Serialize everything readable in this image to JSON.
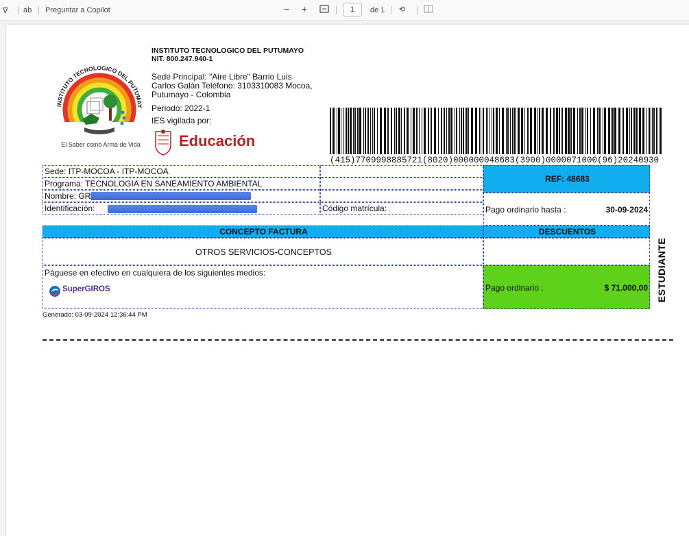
{
  "toolbar": {
    "copilot_label": "Preguntar a Copilot",
    "zoom_out": "−",
    "zoom_in": "+",
    "page_current": "1",
    "page_of": "de 1"
  },
  "header": {
    "institution": "INSTITUTO TECNOLOGICO DEL PUTUMAYO",
    "nit": "NIT. 800.247.940-1",
    "address": "Sede Principal: \"Aire Libre\" Barrio Luis Carlos Galán Teléfono: 3103310083 Mocoa, Putumayo - Colombia",
    "periodo": "Periodo: 2022-1",
    "ies": "IES vigilada por:",
    "education_logo_text": "Educación",
    "logo_ring_text": "INSTITUTO TECNOLOGICO DEL PUTUMAYO",
    "logo_caption": "El Saber como Arma de Vida"
  },
  "barcode": {
    "text": "(415)7709998885721(8020)000000048683(3900)0000071000(96)20240930"
  },
  "invoice": {
    "sede": "Sede: ITP-MOCOA - ITP-MOCOA",
    "programa": "Programa: TECNOLOGIA EN SANEAMIENTO AMBIENTAL",
    "nombre": "Nombre: GR",
    "identificacion": "Identificación:",
    "codigo_matricula": "Código matrícula:",
    "ref": "REF: 48683",
    "pago_hasta_label": "Pago ordinario hasta :",
    "pago_hasta_date": "30-09-2024",
    "concepto_header": "CONCEPTO FACTURA",
    "descuentos_header": "DESCUENTOS",
    "concepto_value": "OTROS SERVICIOS-CONCEPTOS",
    "paguese": "Páguese en efectivo en cualquiera de los siguientes medios:",
    "supergiros": "SuperGIROS",
    "pago_ordinario_label": "Pago ordinario :",
    "pago_ordinario_value": "$ 71.000,00",
    "vertical_label": "ESTUDIANTE",
    "generado": "Generado: 03-09-2024 12:36:44 PM"
  },
  "colors": {
    "blue_header": "#11adef",
    "green_total": "#5ed11a",
    "education_red": "#b8202a"
  }
}
